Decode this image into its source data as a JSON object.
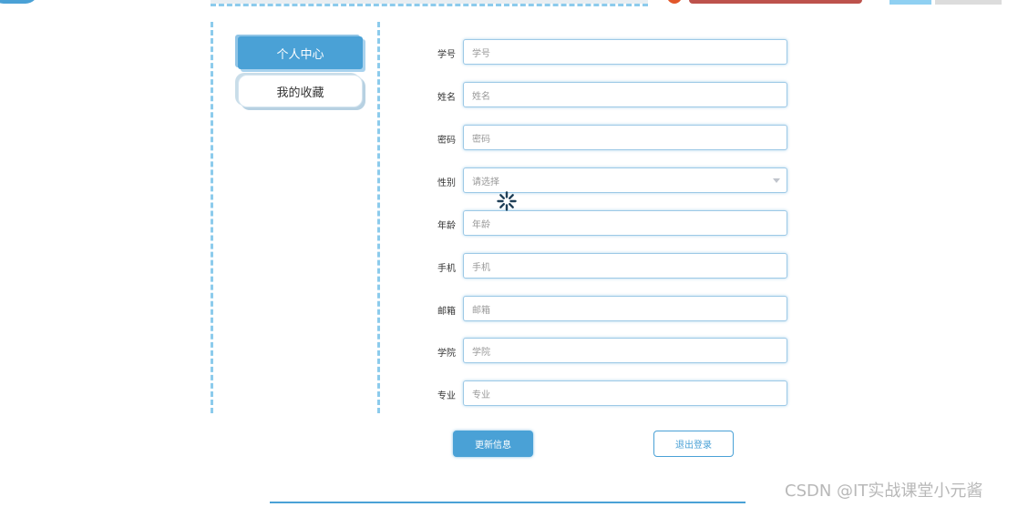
{
  "sidebar": {
    "items": [
      {
        "label": "个人中心",
        "active": true
      },
      {
        "label": "我的收藏",
        "active": false
      }
    ]
  },
  "form": {
    "fields": [
      {
        "label": "学号",
        "placeholder": "学号"
      },
      {
        "label": "姓名",
        "placeholder": "姓名"
      },
      {
        "label": "密码",
        "placeholder": "密码"
      },
      {
        "label": "性别",
        "placeholder": "请选择",
        "type": "select"
      },
      {
        "label": "年龄",
        "placeholder": "年龄"
      },
      {
        "label": "手机",
        "placeholder": "手机"
      },
      {
        "label": "邮箱",
        "placeholder": "邮箱"
      },
      {
        "label": "学院",
        "placeholder": "学院"
      },
      {
        "label": "专业",
        "placeholder": "专业"
      }
    ]
  },
  "actions": {
    "update_label": "更新信息",
    "logout_label": "退出登录"
  },
  "watermark": "CSDN @IT实战课堂小元酱",
  "colors": {
    "accent": "#4aa1d6",
    "dash": "#8ccbec"
  },
  "icons": {
    "loading": "loading-spinner-icon",
    "select": "chevron-down-icon"
  }
}
